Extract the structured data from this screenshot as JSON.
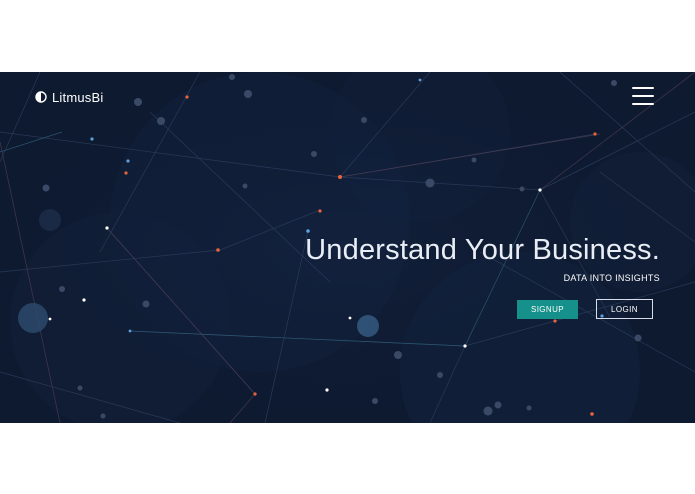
{
  "header": {
    "brand_name": "LitmusBi",
    "logo_icon": "half-moon-logo-icon",
    "menu_icon": "hamburger-menu-icon"
  },
  "hero": {
    "headline": "Understand Your Business.",
    "tagline": "DATA INTO INSIGHTS",
    "signup_label": "SIGNUP",
    "login_label": "LOGIN"
  },
  "colors": {
    "background": "#0e1a30",
    "accent_button": "#15908a",
    "node_orange": "#e8643c",
    "node_blue": "#5aa0e0",
    "node_white": "#ffffff"
  }
}
